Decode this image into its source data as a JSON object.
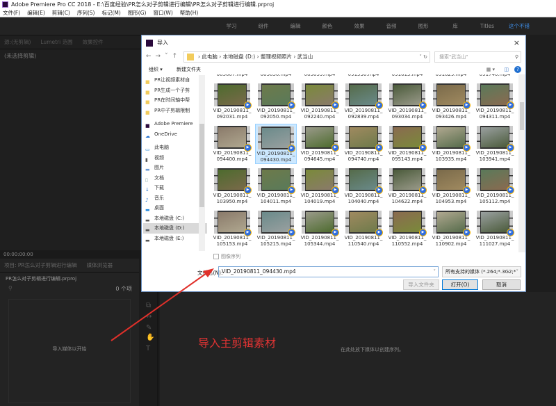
{
  "app": {
    "title": "Adobe Premiere Pro CC 2018 - E:\\百度经验\\PR怎么对子剪辑进行编辑\\PR怎么对子剪辑进行编辑.prproj"
  },
  "menu": [
    "文件(F)",
    "编辑(E)",
    "剪辑(C)",
    "序列(S)",
    "标记(M)",
    "图形(G)",
    "窗口(W)",
    "帮助(H)"
  ],
  "workspaces": [
    "学习",
    "组件",
    "编辑",
    "颜色",
    "效果",
    "音频",
    "图形",
    "库",
    "Titles",
    "这个不错"
  ],
  "workspace_active": "这个不错",
  "source_panel": {
    "tabs": [
      "源:(无剪辑)",
      "Lumetri 范围",
      "效果控件"
    ],
    "empty": "(未选择剪辑)",
    "timecode": "00:00:00:00"
  },
  "project_panel": {
    "tabs": [
      "项目: PR怎么对子剪辑进行编辑",
      "媒体浏览器"
    ],
    "file": "PR怎么对子剪辑进行编辑.prproj",
    "count": "0 个项",
    "empty": "导入媒体以开始"
  },
  "timeline": {
    "empty": "在此处放下媒体以创建序列。"
  },
  "annotation": "导入主剪辑素材",
  "dialog": {
    "title": "导入",
    "close": "×",
    "breadcrumb": [
      "此电脑",
      "本地磁盘 (D:)",
      "整理视频照片",
      "武当山"
    ],
    "search_placeholder": "搜索\"武当山\"",
    "organize": "组织 ▾",
    "new_folder": "新建文件夹",
    "nav": [
      {
        "label": "PR让视频素材自",
        "icon": "folder"
      },
      {
        "label": "PR生成一个子剪",
        "icon": "folder"
      },
      {
        "label": "PR在时间轴中帮",
        "icon": "folder"
      },
      {
        "label": "PR中子剪辑限制",
        "icon": "folder"
      },
      {
        "label": "Adobe Premiere",
        "icon": "premiere"
      },
      {
        "label": "OneDrive",
        "icon": "cloud"
      },
      {
        "label": "此电脑",
        "icon": "pc"
      },
      {
        "label": "视频",
        "icon": "video"
      },
      {
        "label": "图片",
        "icon": "pictures"
      },
      {
        "label": "文档",
        "icon": "documents"
      },
      {
        "label": "下载",
        "icon": "download"
      },
      {
        "label": "音乐",
        "icon": "music"
      },
      {
        "label": "桌面",
        "icon": "desktop"
      },
      {
        "label": "本地磁盘 (C:)",
        "icon": "drive"
      },
      {
        "label": "本地磁盘 (D:)",
        "icon": "drive",
        "selected": true
      },
      {
        "label": "本地磁盘 (E:)",
        "icon": "drive"
      }
    ],
    "partial_row": [
      "085607.mp4",
      "085850.mp4",
      "085859.mp4",
      "091536.mp4",
      "091613.mp4",
      "091629.mp4",
      "091740.mp4"
    ],
    "files": [
      "092031",
      "092050",
      "092240",
      "092839",
      "093034",
      "093426",
      "094311",
      "094400",
      "094430",
      "094645",
      "094740",
      "095143",
      "103935",
      "103941",
      "103950",
      "104011",
      "104019",
      "104040",
      "104622",
      "104953",
      "105112",
      "105153",
      "105215",
      "105344",
      "110540",
      "110552",
      "110902",
      "111027"
    ],
    "file_prefix": "VID_20190811_",
    "file_suffix": ".mp4",
    "selected_file": "094430",
    "image_sequence": "图像序列",
    "filename_label": "文件名(N):",
    "filename_value": "VID_20190811_094430.mp4",
    "filter": "所有支持的媒体 (*.264;*.3G2;*",
    "import_folder": "导入文件夹",
    "open": "打开(O)",
    "cancel": "取消"
  }
}
